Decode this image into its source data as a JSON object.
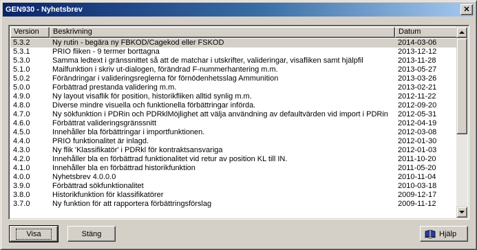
{
  "window": {
    "title": "GEN930 - Nyhetsbrev",
    "close_label": "✕"
  },
  "list": {
    "columns": [
      "Version",
      "Beskrivning",
      "Datum"
    ],
    "rows": [
      {
        "version": "5.3.2",
        "description": "Ny rutin - begära ny FBKOD/Cagekod eller FSKOD",
        "date": "2014-03-06"
      },
      {
        "version": "5.3.1",
        "description": "PRIO fliken - 9 termer borttagna",
        "date": "2013-12-12"
      },
      {
        "version": "5.3.0",
        "description": "Samma ledtext i gränssnittet så att de matchar i utskrifter, valideringar, visafliken samt hjälpfil",
        "date": "2013-11-28"
      },
      {
        "version": "5.1.0",
        "description": "Mailfunktion i skriv ut-dialogen, förändrad F-nummerhantering m.m.",
        "date": "2013-05-27"
      },
      {
        "version": "5.0.2",
        "description": "Förändringar i valideringsreglerna för förnödenhetsslag Ammunition",
        "date": "2013-03-26"
      },
      {
        "version": "5.0.0",
        "description": "Förbättrad prestanda validering m.m.",
        "date": "2013-02-21"
      },
      {
        "version": "4.9.0",
        "description": "Ny layout visaflik för position, historikfliken alltid synlig m.m.",
        "date": "2012-11-22"
      },
      {
        "version": "4.8.0",
        "description": "Diverse mindre visuella och funktionella förbättringar införda.",
        "date": "2012-09-20"
      },
      {
        "version": "4.7.0",
        "description": "Ny sökfunktion i PDRin och PDRklMöjlighet att välja användning av defaultvärden vid import i PDRin",
        "date": "2012-05-31"
      },
      {
        "version": "4.6.0",
        "description": "Förbättrat valideringsgränssnitt",
        "date": "2012-04-19"
      },
      {
        "version": "4.5.0",
        "description": "Innehåller bla förbättringar i importfunktionen.",
        "date": "2012-03-08"
      },
      {
        "version": "4.4.0",
        "description": "PRIO funktionalitet är inlagd.",
        "date": "2012-01-30"
      },
      {
        "version": "4.3.0",
        "description": "Ny flik 'Klassifikatör' i PDRkl för kontraktsansvariga",
        "date": "2012-01-03"
      },
      {
        "version": "4.2.0",
        "description": "Innehåller bla en förbättrad funktionalitet vid retur av position KL till IN.",
        "date": "2011-10-20"
      },
      {
        "version": "4.1.0",
        "description": "Innehåller bla en förbättrad historikfunktion",
        "date": "2011-05-20"
      },
      {
        "version": "4.0.0",
        "description": "Nyhetsbrev 4.0.0.0",
        "date": "2010-11-04"
      },
      {
        "version": "3.9.0",
        "description": "Förbättrad sökfunktionalitet",
        "date": "2010-03-18"
      },
      {
        "version": "3.8.0",
        "description": "Historikfunktion för klassifikatörer",
        "date": "2009-12-17"
      },
      {
        "version": "3.7.0",
        "description": "Ny funktion för att rapportera förbättringsförslag",
        "date": "2009-11-12"
      }
    ],
    "selected_index": 0
  },
  "buttons": {
    "show": "Visa",
    "close": "Stäng",
    "help": "Hjälp"
  },
  "icons": {
    "help": "book-icon",
    "close": "close-icon",
    "scroll_up": "arrow-up-icon",
    "scroll_down": "arrow-down-icon"
  },
  "colors": {
    "title_start": "#0a246a",
    "title_end": "#a6caf0",
    "face": "#d4d0c8"
  }
}
